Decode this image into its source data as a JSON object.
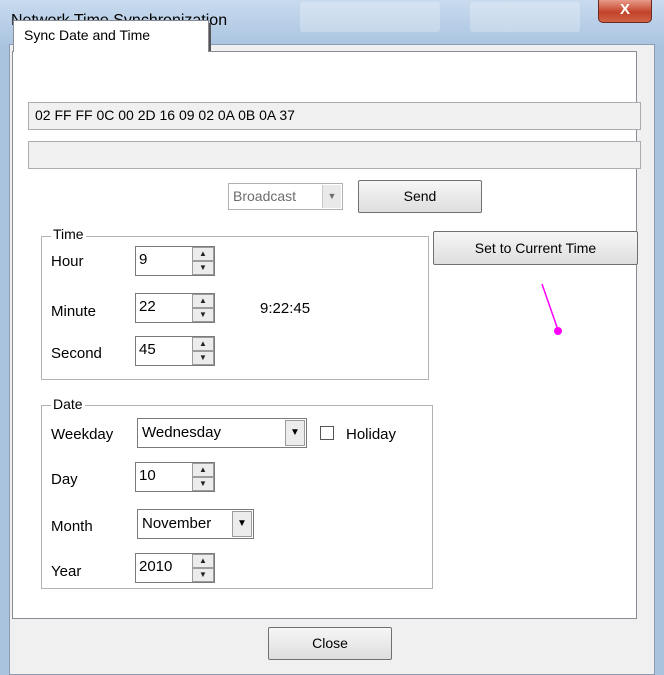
{
  "window": {
    "title": "Network Time Synchronization",
    "close_glyph": "X"
  },
  "tab": {
    "label": "Sync Date and Time"
  },
  "hex_output": "02 FF FF 0C 00 2D 16 09 02 0A 0B 0A 37",
  "status_field": "",
  "broadcast": {
    "value": "Broadcast",
    "dropdown_glyph": "▼"
  },
  "send_label": "Send",
  "set_current_label": "Set to Current Time",
  "time_group": {
    "legend": "Time",
    "hour_label": "Hour",
    "hour_value": "9",
    "minute_label": "Minute",
    "minute_value": "22",
    "second_label": "Second",
    "second_value": "45",
    "display": "9:22:45"
  },
  "date_group": {
    "legend": "Date",
    "weekday_label": "Weekday",
    "weekday_value": "Wednesday",
    "holiday_label": "Holiday",
    "day_label": "Day",
    "day_value": "10",
    "month_label": "Month",
    "month_value": "November",
    "year_label": "Year",
    "year_value": "2010"
  },
  "close_label": "Close",
  "spin_up_glyph": "▲",
  "spin_down_glyph": "▼",
  "icons": [
    "close-icon",
    "spin-up-icon",
    "spin-down-icon",
    "dropdown-arrow-icon"
  ],
  "colors": {
    "annotation_marker": "#ff00ff",
    "titlebar": "#b6cde6"
  }
}
